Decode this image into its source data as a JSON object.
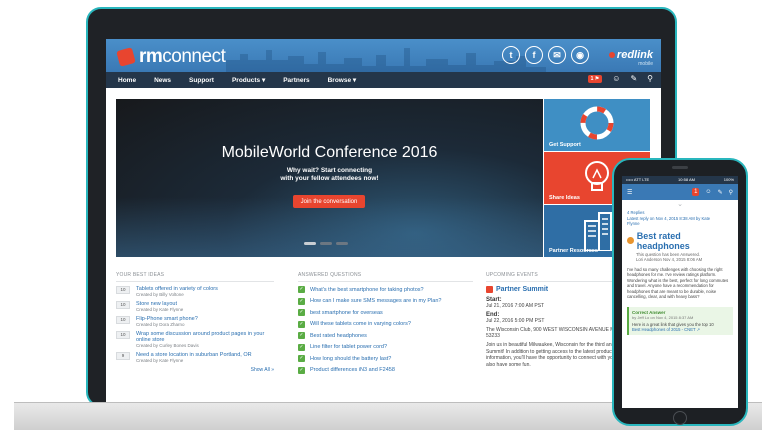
{
  "header": {
    "logo_prefix": "rm",
    "logo_suffix": "connect",
    "social": [
      "t",
      "f",
      "✉",
      "◉"
    ],
    "partner_logo": "redlink",
    "partner_sub": "mobile"
  },
  "nav": {
    "items": [
      "Home",
      "News",
      "Support",
      "Products ▾",
      "Partners",
      "Browse ▾"
    ],
    "badge": "1 ⚑",
    "icons": [
      "user-icon",
      "pencil-icon",
      "search-icon"
    ]
  },
  "hero": {
    "title": "MobileWorld Conference 2016",
    "subtitle_line1": "Why wait? Start connecting",
    "subtitle_line2": "with your fellow attendees now!",
    "button": "Join the conversation"
  },
  "tiles": [
    {
      "label": "Get Support",
      "color": "#3f8fc4"
    },
    {
      "label": "Share Ideas",
      "color": "#e8452f"
    },
    {
      "label": "Partner Resources",
      "color": "#2f6ea5"
    }
  ],
  "ideas": {
    "heading": "YOUR BEST IDEAS",
    "items": [
      {
        "count": "10",
        "title": "Tablets offered in variety of colors",
        "meta": "Created by Billy Voltone"
      },
      {
        "count": "10",
        "title": "Store new layout",
        "meta": "Created by Kate Flynne"
      },
      {
        "count": "10",
        "title": "Flip-Phone smart phone?",
        "meta": "Created by Dora Zharno"
      },
      {
        "count": "10",
        "title": "Wrap some discussion around product pages in your online store",
        "meta": "Created by Curley Bones Davis"
      },
      {
        "count": "9",
        "title": "Need a store location in suburban Portland, OR",
        "meta": "Created by Kate Flynne"
      }
    ],
    "show_all": "Show All »"
  },
  "questions": {
    "heading": "ANSWERED QUESTIONS",
    "items": [
      "What's the best smartphone for taking photos?",
      "How can I make sure SMS messages are in my Plan?",
      "best smartphone for overseas",
      "Will these tablets come in varying colors?",
      "Best rated headphones",
      "Line filter for tablet power cord?",
      "How long should the battery last?",
      "Product differences iN3 and F2458"
    ]
  },
  "events": {
    "heading": "UPCOMING EVENTS",
    "title": "Partner Summit",
    "start_label": "Start:",
    "start_value": "Jul 21, 2016 7:00 AM PST",
    "end_label": "End:",
    "end_value": "Jul 22, 2016 5:00 PM PST",
    "location": "The Wisconsin Club, 900 WEST WISCONSIN AVENUE MILWAUKEE, WI 53233",
    "desc": "Join us in beautiful Milwaukee, Wisconsin for the third annual Partner Summit! In addition to getting access to the latest products and information, you'll have the opportunity to connect with your peers, and also have some fun."
  },
  "phone": {
    "status_left": "••••• ATT LTE",
    "status_center": "10:58 AM",
    "status_right": "100%",
    "replies_line1": "4 Replies",
    "replies_line2": "Latest reply on Nov 4, 2015 8:38 AM by Kate",
    "replies_line3": "Flynne",
    "title": "Best rated headphones",
    "solved_line1": "This question has been Answered.",
    "solved_answered": "Answered",
    "solved_line2": "Lori Anderson Nov 4, 2015 8:06 AM",
    "body": "I've had so many challenges with choosing the right headphones for me. I've review ratings platform. Wondering what is the best, perfect for long commutes and travel. Anyone have a recommendation for headphones that are meant to be durable, noise cancelling, clear, and with heavy bass?",
    "answer_head": "Correct Answer",
    "answer_meta": "by Jeff Lo on Nov 4, 2015 8:37 AM",
    "answer_text": "Here is a great link that gives you the top 10",
    "answer_link": "Best Headphones of 2015 - CNET ↗"
  }
}
